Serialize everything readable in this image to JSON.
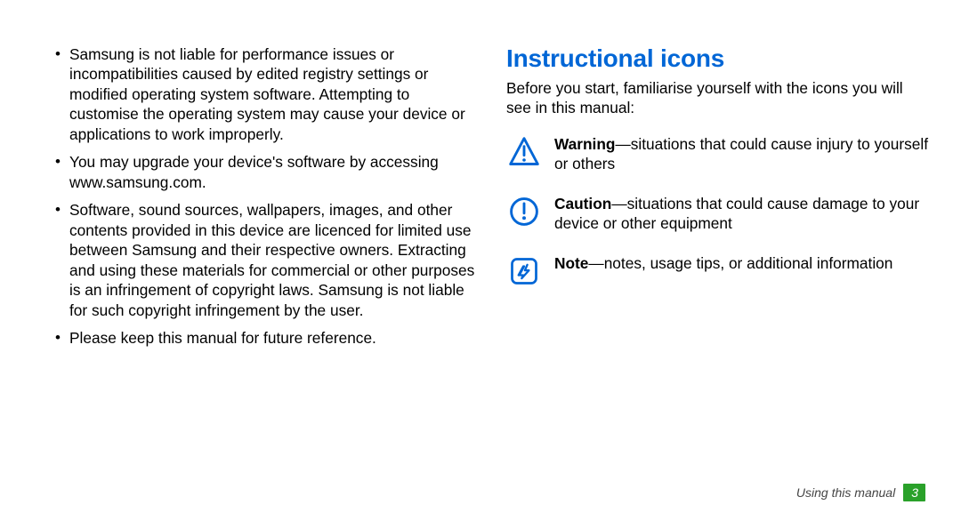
{
  "left": {
    "bullets": [
      "Samsung is not liable for performance issues or incompatibilities caused by edited registry settings or modified operating system software. Attempting to customise the operating system may cause your device or applications to work improperly.",
      "You may upgrade your device's software by accessing www.samsung.com.",
      "Software, sound sources, wallpapers, images, and other contents provided in this device are licenced for limited use between Samsung and their respective owners. Extracting and using these materials for commercial or other purposes is an infringement of copyright laws. Samsung is not liable for such copyright infringement by the user.",
      "Please keep this manual for future reference."
    ]
  },
  "right": {
    "title": "Instructional icons",
    "intro": "Before you start, familiarise yourself with the icons you will see in this manual:",
    "rows": [
      {
        "icon": "warning-icon",
        "bold": "Warning",
        "rest": "—situations that could cause injury to yourself or others"
      },
      {
        "icon": "caution-icon",
        "bold": "Caution",
        "rest": "—situations that could cause damage to your device or other equipment"
      },
      {
        "icon": "note-icon",
        "bold": "Note",
        "rest": "—notes, usage tips, or additional information"
      }
    ]
  },
  "footer": {
    "label": "Using this manual",
    "page": "3"
  },
  "colors": {
    "accent": "#0066d6",
    "badge": "#2aa12a"
  }
}
